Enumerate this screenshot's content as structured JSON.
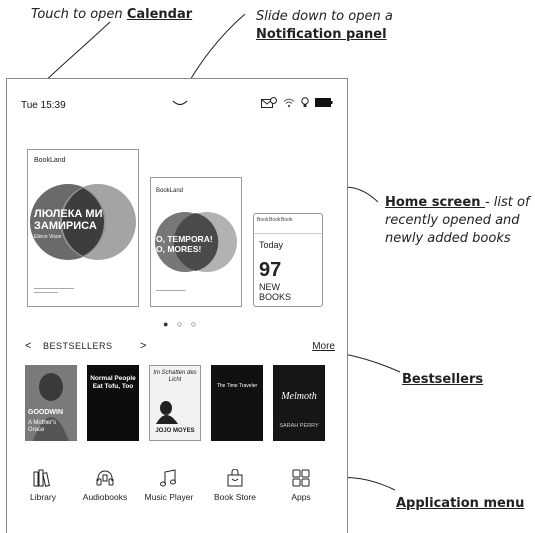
{
  "annotations": {
    "calendar_prefix": "Touch to open ",
    "calendar_link": "Calendar",
    "notification_line1": "Slide down to open a",
    "notification_link": "Notification panel",
    "home_link": "Home screen ",
    "home_text1": "- list of",
    "home_text2": "recently opened and",
    "home_text3": "newly added books",
    "bestsellers_link": "Bestsellers",
    "appmenu_link": "Application menu"
  },
  "status_bar": {
    "time": "Tue 15:39",
    "icons": [
      "notification-envelope-icon",
      "wifi-icon",
      "bulb-icon",
      "battery-icon"
    ]
  },
  "carousel": {
    "book1": {
      "publisher": "BookLand",
      "title_line1": "ЛЮЛЕКА МИ",
      "title_line2": "ЗАМИРИСА",
      "author": "Elince Vison"
    },
    "book2": {
      "publisher": "BookLand",
      "title_line1": "O, TEMPORA!",
      "title_line2": "O, MORES!"
    },
    "book3": {
      "publisher": "Book",
      "label": "Today",
      "count": "97",
      "line1": "NEW",
      "line2": "BOOKS"
    },
    "dots": "● ○ ○"
  },
  "bestsellers": {
    "prev": "<",
    "title": "BESTSELLERS",
    "next": ">",
    "more": "More",
    "books": [
      {
        "author": "GOODWIN",
        "title": "A Mother's Grace"
      },
      {
        "title": "Normal People Eat Tofu, Too"
      },
      {
        "title": "Im Schatten des Licht",
        "author": "JOJO MOYES"
      },
      {
        "title": "The Time Traveler"
      },
      {
        "title": "Melmoth",
        "author": "SARAH PERRY"
      }
    ]
  },
  "dock": {
    "items": [
      {
        "label": "Library",
        "icon": "library-icon"
      },
      {
        "label": "Audiobooks",
        "icon": "headphones-icon"
      },
      {
        "label": "Music Player",
        "icon": "music-note-icon"
      },
      {
        "label": "Book Store",
        "icon": "shopping-bag-icon"
      },
      {
        "label": "Apps",
        "icon": "apps-grid-icon"
      }
    ]
  }
}
